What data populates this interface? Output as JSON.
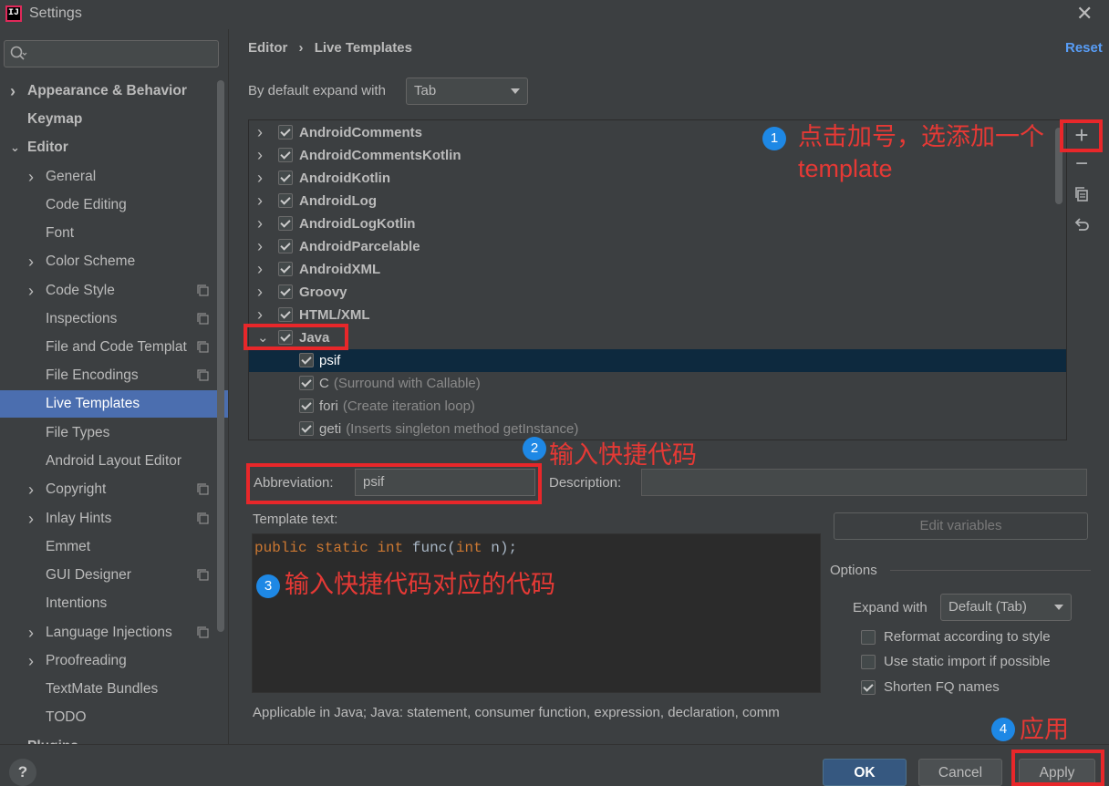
{
  "window": {
    "title": "Settings",
    "app_icon": "IJ"
  },
  "search": {
    "placeholder": ""
  },
  "sidebar": {
    "items": [
      {
        "label": "Appearance & Behavior",
        "level": 0,
        "expandable": true,
        "bold": true,
        "copy_icon": false
      },
      {
        "label": "Keymap",
        "level": 0,
        "expandable": false,
        "bold": true,
        "copy_icon": false
      },
      {
        "label": "Editor",
        "level": 0,
        "expandable": true,
        "expanded": true,
        "bold": true,
        "copy_icon": false
      },
      {
        "label": "General",
        "level": 1,
        "expandable": true,
        "copy_icon": false
      },
      {
        "label": "Code Editing",
        "level": 1,
        "expandable": false,
        "copy_icon": false
      },
      {
        "label": "Font",
        "level": 1,
        "expandable": false,
        "copy_icon": false
      },
      {
        "label": "Color Scheme",
        "level": 1,
        "expandable": true,
        "copy_icon": false
      },
      {
        "label": "Code Style",
        "level": 1,
        "expandable": true,
        "copy_icon": true
      },
      {
        "label": "Inspections",
        "level": 1,
        "expandable": false,
        "copy_icon": true
      },
      {
        "label": "File and Code Templat",
        "level": 1,
        "expandable": false,
        "copy_icon": true
      },
      {
        "label": "File Encodings",
        "level": 1,
        "expandable": false,
        "copy_icon": true
      },
      {
        "label": "Live Templates",
        "level": 1,
        "expandable": false,
        "selected": true,
        "copy_icon": false
      },
      {
        "label": "File Types",
        "level": 1,
        "expandable": false,
        "copy_icon": false
      },
      {
        "label": "Android Layout Editor",
        "level": 1,
        "expandable": false,
        "copy_icon": false
      },
      {
        "label": "Copyright",
        "level": 1,
        "expandable": true,
        "copy_icon": true
      },
      {
        "label": "Inlay Hints",
        "level": 1,
        "expandable": true,
        "copy_icon": true
      },
      {
        "label": "Emmet",
        "level": 1,
        "expandable": false,
        "copy_icon": false
      },
      {
        "label": "GUI Designer",
        "level": 1,
        "expandable": false,
        "copy_icon": true
      },
      {
        "label": "Intentions",
        "level": 1,
        "expandable": false,
        "copy_icon": false
      },
      {
        "label": "Language Injections",
        "level": 1,
        "expandable": true,
        "copy_icon": true
      },
      {
        "label": "Proofreading",
        "level": 1,
        "expandable": true,
        "copy_icon": false
      },
      {
        "label": "TextMate Bundles",
        "level": 1,
        "expandable": false,
        "copy_icon": false
      },
      {
        "label": "TODO",
        "level": 1,
        "expandable": false,
        "copy_icon": false
      },
      {
        "label": "Plugins",
        "level": 0,
        "expandable": false,
        "bold": true,
        "copy_icon": false
      }
    ]
  },
  "header": {
    "crumb1": "Editor",
    "separator": "›",
    "crumb2": "Live Templates",
    "reset": "Reset"
  },
  "expand_default": {
    "label": "By default expand with",
    "value": "Tab"
  },
  "template_tree": [
    {
      "label": "AndroidComments",
      "group": true,
      "checked": true
    },
    {
      "label": "AndroidCommentsKotlin",
      "group": true,
      "checked": true
    },
    {
      "label": "AndroidKotlin",
      "group": true,
      "checked": true
    },
    {
      "label": "AndroidLog",
      "group": true,
      "checked": true
    },
    {
      "label": "AndroidLogKotlin",
      "group": true,
      "checked": true
    },
    {
      "label": "AndroidParcelable",
      "group": true,
      "checked": true
    },
    {
      "label": "AndroidXML",
      "group": true,
      "checked": true
    },
    {
      "label": "Groovy",
      "group": true,
      "checked": true
    },
    {
      "label": "HTML/XML",
      "group": true,
      "checked": true
    },
    {
      "label": "Java",
      "group": true,
      "expanded": true,
      "checked": true
    },
    {
      "label": "psif",
      "group": false,
      "checked": true,
      "selected": true,
      "desc": ""
    },
    {
      "label": "C",
      "group": false,
      "checked": true,
      "desc": "(Surround with Callable)"
    },
    {
      "label": "fori",
      "group": false,
      "checked": true,
      "desc": "(Create iteration loop)"
    },
    {
      "label": "geti",
      "group": false,
      "checked": true,
      "desc": "(Inserts singleton method getInstance)"
    }
  ],
  "toolbar": {
    "add": "+",
    "remove": "−",
    "copy_icon": "copy-icon",
    "restore_icon": "restore-icon"
  },
  "form": {
    "abbreviation_label": "Abbreviation:",
    "abbreviation_value": "psif",
    "description_label": "Description:",
    "description_value": "",
    "template_text_label": "Template text:",
    "edit_variables": "Edit variables",
    "applicable": "Applicable in Java; Java: statement, consumer function, expression, declaration, comm"
  },
  "code": {
    "kw1": "public",
    "kw2": "static",
    "kw3": "int",
    "fn": "func(",
    "kw4": "int",
    "rest": "n);"
  },
  "options": {
    "title": "Options",
    "expand_with_label": "Expand with",
    "expand_with_value": "Default (Tab)",
    "reformat": {
      "label": "Reformat according to style",
      "checked": false
    },
    "static_import": {
      "label": "Use static import if possible",
      "checked": false
    },
    "shorten_fq": {
      "label": "Shorten FQ names",
      "checked": true
    }
  },
  "buttons": {
    "help": "?",
    "ok": "OK",
    "cancel": "Cancel",
    "apply": "Apply"
  },
  "annotations": {
    "n1": "1",
    "t1_line1": "点击加号，选添加一个",
    "t1_line2": "template",
    "n2": "2",
    "t2": "输入快捷代码",
    "n3": "3",
    "t3": "输入快捷代码对应的代码",
    "n4": "4",
    "t4": "应用"
  },
  "colors": {
    "accent": "#4b6eaf",
    "link": "#589df6",
    "annotation_red": "#e8272a",
    "annotation_blue": "#1e88e5"
  }
}
